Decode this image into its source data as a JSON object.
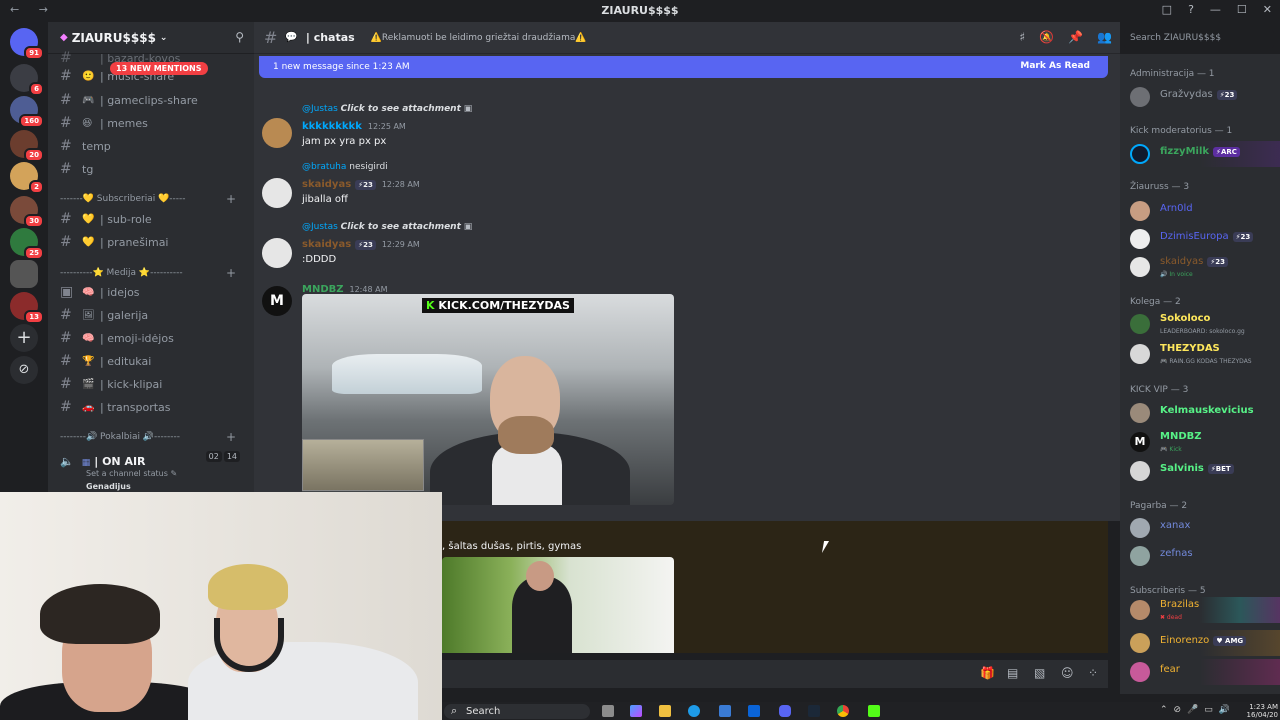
{
  "window": {
    "title": "ZIAURU$$$$",
    "controls": [
      "□",
      "?",
      "—",
      "☐",
      "✕"
    ]
  },
  "server": {
    "name": "ZIAURU$$$$",
    "mentions_badge": "13 NEW MENTIONS"
  },
  "rail": {
    "badges": [
      "91",
      "6",
      "160",
      "20",
      "2",
      "30",
      "25",
      "13"
    ]
  },
  "channels": [
    {
      "label": "| bazard-kovos",
      "emoji": ""
    },
    {
      "label": "| music-share",
      "emoji": "🙂"
    },
    {
      "label": "| gameclips-share",
      "emoji": "🎮"
    },
    {
      "label": "| memes",
      "emoji": "😆"
    },
    {
      "label": "temp",
      "emoji": ""
    },
    {
      "label": "tg",
      "emoji": ""
    }
  ],
  "categories": {
    "subscriberiai": "-------💛 Subscriberiai 💛-----",
    "medija": "----------⭐ Medija ⭐----------",
    "pokalbiai": "--------🔊 Pokalbiai 🔊--------"
  },
  "sub_channels": [
    {
      "label": "| sub-role",
      "emoji": "💛"
    },
    {
      "label": "| pranešimai",
      "emoji": "💛"
    }
  ],
  "media_channels": [
    {
      "label": "| idejos",
      "emoji": "🧠"
    },
    {
      "label": "| galerija",
      "emoji": "🖼"
    },
    {
      "label": "| emoji-idėjos",
      "emoji": "🧠"
    },
    {
      "label": "| editukai",
      "emoji": "🏆"
    },
    {
      "label": "| kick-klipai",
      "emoji": "🎬"
    },
    {
      "label": "| transportas",
      "emoji": "🚗"
    }
  ],
  "voice": {
    "name": "| ON AIR",
    "status": "Set a channel status ✎",
    "count_a": "02",
    "count_b": "14",
    "next_user": "Genadijus"
  },
  "header": {
    "channel": "| chatas",
    "topic": "⚠️Reklamuoti be leidimo griežtai draudžiama⚠️",
    "search_placeholder": "Search ZIAURU$$$$"
  },
  "banner": {
    "text": "1 new message since 1:23 AM",
    "action": "Mark As Read"
  },
  "messages": [
    {
      "reply_user": "@Justas",
      "reply_text": "Click to see attachment",
      "author": "kkkkkkkkk",
      "author_color": "#00a8fc",
      "time": "12:25 AM",
      "level": "",
      "body": "jam px yra px px"
    },
    {
      "reply_user": "@bratuha",
      "reply_text": "nesigirdi",
      "author": "skaidyas",
      "author_color": "#8a5a2b",
      "time": "12:28 AM",
      "level": "⚡23",
      "body": "jiballa off"
    },
    {
      "reply_user": "@Justas",
      "reply_text": "Click to see attachment",
      "author": "skaidyas",
      "author_color": "#8a5a2b",
      "time": "12:29 AM",
      "level": "⚡23",
      "body": ":DDDD"
    },
    {
      "reply_user": "",
      "reply_text": "",
      "author": "MNDBZ",
      "author_color": "#3ba55d",
      "time": "12:48 AM",
      "level": "",
      "body": ""
    }
  ],
  "media": {
    "watermark_prefix": "K",
    "watermark": "KICK.COM/THEZYDAS",
    "caption2": ", šaltas dušas, pirtis, gymas"
  },
  "members": {
    "groups": [
      {
        "title": "Administracija — 1"
      },
      {
        "title": "Kick moderatorius — 1"
      },
      {
        "title": "Žiauruss — 3"
      },
      {
        "title": "Kolega — 2"
      },
      {
        "title": "KICK VIP — 3"
      },
      {
        "title": "Pagarba — 2"
      },
      {
        "title": "Subscriberis — 5"
      }
    ],
    "list": [
      {
        "name": "Gražvydas",
        "color": "#949ba4",
        "tag": "⚡23",
        "sub": ""
      },
      {
        "name": "fizzyMilk",
        "color": "#3ba55d",
        "tag": "⚡ARC",
        "sub": ""
      },
      {
        "name": "Arn0ld",
        "color": "#5865f2",
        "tag": "",
        "sub": ""
      },
      {
        "name": "DzimisEuropa",
        "color": "#5865f2",
        "tag": "⚡23",
        "sub": ""
      },
      {
        "name": "skaidyas",
        "color": "#8a5a2b",
        "tag": "⚡23",
        "sub": "🔊 In voice"
      },
      {
        "name": "Sokoloco",
        "color": "#fee75c",
        "tag": "",
        "sub": "LEADERBOARD: sokoloco.gg"
      },
      {
        "name": "THEZYDAS",
        "color": "#fee75c",
        "tag": "",
        "sub": "🎮 RAIN.GG KODAS THEZYDAS"
      },
      {
        "name": "Kelmauskevicius",
        "color": "#57f287",
        "tag": "",
        "sub": ""
      },
      {
        "name": "MNDBZ",
        "color": "#57f287",
        "tag": "",
        "sub": "🎮 Kick"
      },
      {
        "name": "Salvinis",
        "color": "#57f287",
        "tag": "⚡BET",
        "sub": ""
      },
      {
        "name": "xanax",
        "color": "#7289da",
        "tag": "",
        "sub": ""
      },
      {
        "name": "zefnas",
        "color": "#7289da",
        "tag": "",
        "sub": ""
      },
      {
        "name": "Brazilas",
        "color": "#f0b232",
        "tag": "",
        "sub": "✖ dead"
      },
      {
        "name": "Einorenzo",
        "color": "#f0b232",
        "tag": "♥ AMG",
        "sub": ""
      },
      {
        "name": "fear",
        "color": "#f0b232",
        "tag": "",
        "sub": ""
      }
    ]
  },
  "taskbar": {
    "search": "Search",
    "time": "1:23 AM",
    "date": "16/04/20"
  },
  "colors": {
    "accent": "#5865f2",
    "bg": "#313338",
    "sidebar": "#2b2d31",
    "mention": "#f23f43"
  }
}
